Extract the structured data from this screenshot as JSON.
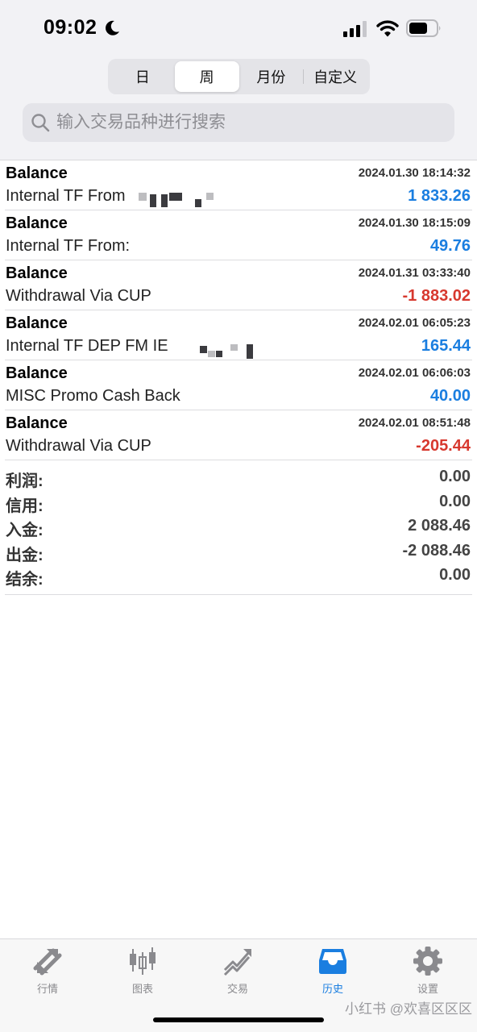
{
  "status_bar": {
    "time": "09:02"
  },
  "period_tabs": [
    {
      "label": "日",
      "active": false
    },
    {
      "label": "周",
      "active": true
    },
    {
      "label": "月份",
      "active": false
    },
    {
      "label": "自定义",
      "active": false
    }
  ],
  "search": {
    "placeholder": "输入交易品种进行搜索"
  },
  "transactions": [
    {
      "type": "Balance",
      "timestamp": "2024.01.30 18:14:32",
      "description": "Internal TF From",
      "amount": "1 833.26",
      "sign": "positive"
    },
    {
      "type": "Balance",
      "timestamp": "2024.01.30 18:15:09",
      "description": "Internal TF From:",
      "amount": "49.76",
      "sign": "positive"
    },
    {
      "type": "Balance",
      "timestamp": "2024.01.31 03:33:40",
      "description": "Withdrawal Via CUP",
      "amount": "-1 883.02",
      "sign": "negative"
    },
    {
      "type": "Balance",
      "timestamp": "2024.02.01 06:05:23",
      "description": "Internal TF DEP FM IE",
      "amount": "165.44",
      "sign": "positive"
    },
    {
      "type": "Balance",
      "timestamp": "2024.02.01 06:06:03",
      "description": "MISC Promo Cash Back",
      "amount": "40.00",
      "sign": "positive"
    },
    {
      "type": "Balance",
      "timestamp": "2024.02.01 08:51:48",
      "description": "Withdrawal Via CUP",
      "amount": "-205.44",
      "sign": "negative"
    }
  ],
  "summary": [
    {
      "label": "利润:",
      "value": "0.00"
    },
    {
      "label": "信用:",
      "value": "0.00"
    },
    {
      "label": "入金:",
      "value": "2 088.46"
    },
    {
      "label": "出金:",
      "value": "-2 088.46"
    },
    {
      "label": "结余:",
      "value": "0.00"
    }
  ],
  "colors": {
    "positive": "#1a7ee0",
    "negative": "#d7382e",
    "active_tab": "#1a7ee0"
  },
  "tab_bar": [
    {
      "label": "行情",
      "icon": "quotes-arrows-icon",
      "active": false
    },
    {
      "label": "图表",
      "icon": "candlestick-chart-icon",
      "active": false
    },
    {
      "label": "交易",
      "icon": "trade-trend-icon",
      "active": false
    },
    {
      "label": "历史",
      "icon": "history-inbox-icon",
      "active": true
    },
    {
      "label": "设置",
      "icon": "gear-icon",
      "active": false
    }
  ],
  "watermark": "小红书 @欢喜区区区"
}
